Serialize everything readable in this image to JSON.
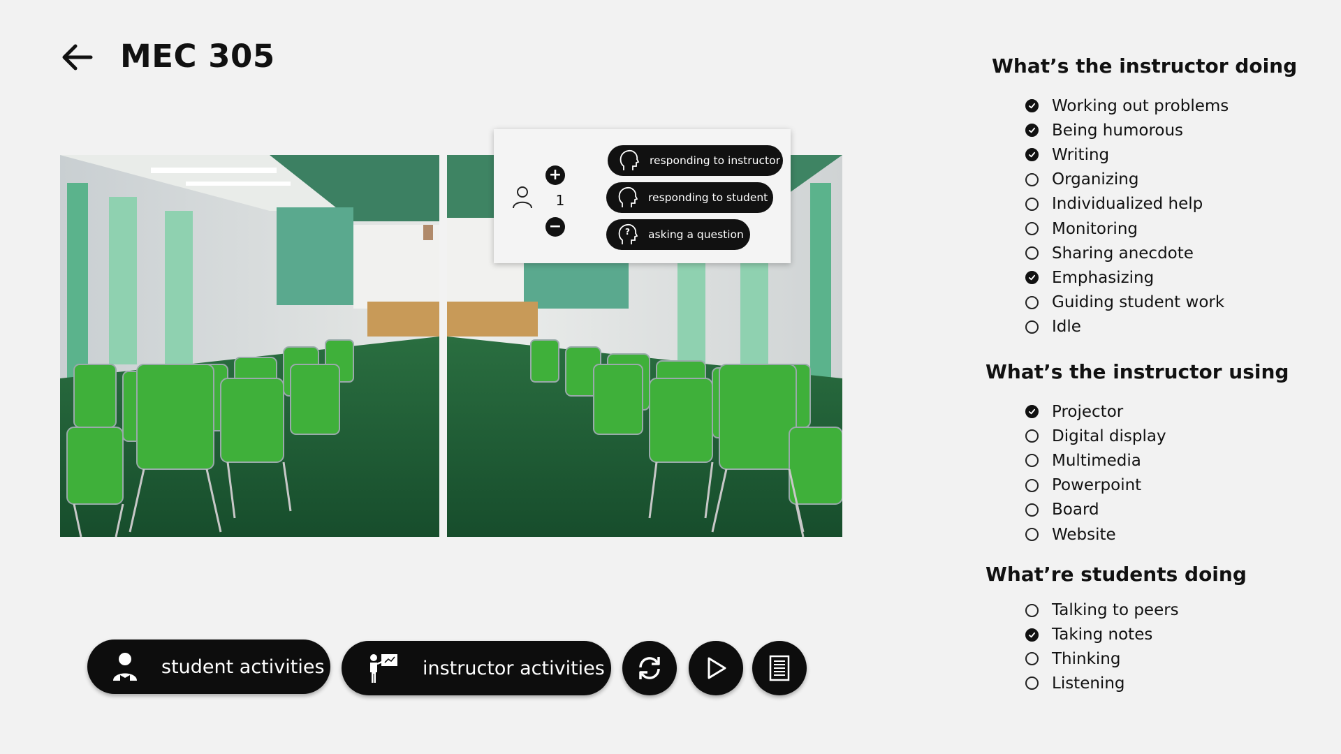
{
  "header": {
    "title": "MEC 305"
  },
  "popup": {
    "count": "1",
    "plus_label": "+",
    "minus_label": "−",
    "actions": [
      {
        "label": "responding to instructor",
        "icon": "head-speaking-icon"
      },
      {
        "label": "responding to student",
        "icon": "head-speaking-icon"
      },
      {
        "label": "asking a question",
        "icon": "head-question-icon"
      }
    ]
  },
  "toolbar": {
    "student_label": "student activities",
    "instructor_label": "instructor activities",
    "refresh_icon": "refresh-icon",
    "play_icon": "play-icon",
    "notes_icon": "notes-icon"
  },
  "panel": {
    "instructor_doing": {
      "title": "What’s the instructor doing",
      "options": [
        {
          "label": "Working out problems",
          "checked": true
        },
        {
          "label": "Being humorous",
          "checked": true
        },
        {
          "label": "Writing",
          "checked": true
        },
        {
          "label": "Organizing",
          "checked": false
        },
        {
          "label": "Individualized help",
          "checked": false
        },
        {
          "label": "Monitoring",
          "checked": false
        },
        {
          "label": "Sharing anecdote",
          "checked": false
        },
        {
          "label": "Emphasizing",
          "checked": true
        },
        {
          "label": "Guiding student work",
          "checked": false
        },
        {
          "label": "Idle",
          "checked": false
        }
      ]
    },
    "instructor_using": {
      "title": "What’s the instructor using",
      "options": [
        {
          "label": "Projector",
          "checked": true
        },
        {
          "label": "Digital display",
          "checked": false
        },
        {
          "label": "Multimedia",
          "checked": false
        },
        {
          "label": "Powerpoint",
          "checked": false
        },
        {
          "label": "Board",
          "checked": false
        },
        {
          "label": "Website",
          "checked": false
        }
      ]
    },
    "students_doing": {
      "title": "What’re students doing",
      "options": [
        {
          "label": "Talking to peers",
          "checked": false
        },
        {
          "label": "Taking notes",
          "checked": true
        },
        {
          "label": "Thinking",
          "checked": false
        },
        {
          "label": "Listening",
          "checked": false
        }
      ]
    }
  },
  "colors": {
    "background": "#f2f2f2",
    "button_black": "#0d0d0d",
    "chair_green": "#3fae3a",
    "carpet_green": "#1f5e36"
  }
}
